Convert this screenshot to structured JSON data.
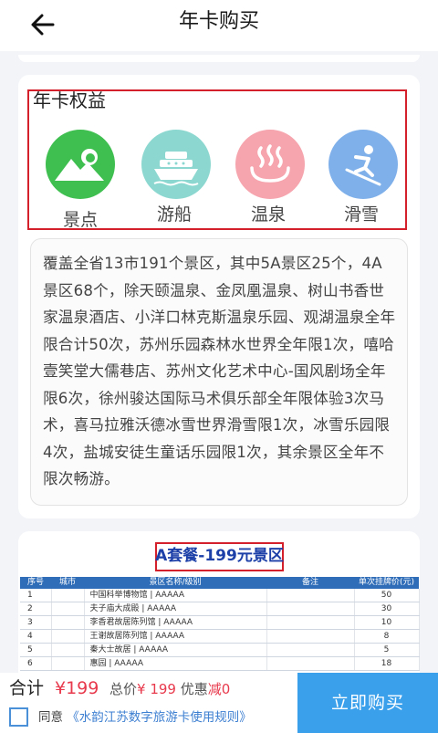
{
  "header": {
    "title": "年卡购买",
    "back_icon": "arrow-left-icon"
  },
  "benefits": {
    "title": "年卡权益",
    "items": [
      {
        "label": "景点",
        "icon": "mountain-sun-icon",
        "color": "#3fbf50"
      },
      {
        "label": "游船",
        "icon": "cruise-ship-icon",
        "color": "#8cd8d0"
      },
      {
        "label": "温泉",
        "icon": "hot-spring-icon",
        "color": "#f6a4ad"
      },
      {
        "label": "滑雪",
        "icon": "skier-icon",
        "color": "#7fb0ea"
      }
    ],
    "description": "覆盖全省13市191个景区，其中5A景区25个，4A景区68个，除天颐温泉、金凤凰温泉、树山书香世家温泉酒店、小洋口林克斯温泉乐园、观湖温泉全年限合计50次，苏州乐园森林水世界全年限1次，嘻哈壹笑堂大儒巷店、苏州文化艺术中心-国风剧场全年限6次，徐州骏达国际马术俱乐部全年限体验3次马术，喜马拉雅沃德冰雪世界滑雪限1次，冰雪乐园限4次，盐城安徒生童话乐园限1次，其余景区全年不限次畅游。"
  },
  "package": {
    "title": "A套餐-199元景区",
    "columns": [
      "序号",
      "城市",
      "景区名称/级别",
      "备注",
      "单次挂牌价(元)"
    ],
    "rows": [
      {
        "no": "1",
        "city": "",
        "name": "中国科举博物馆 | AAAAA",
        "note": "",
        "price": "50"
      },
      {
        "no": "2",
        "city": "",
        "name": "夫子庙大成殿 | AAAAA",
        "note": "",
        "price": "30"
      },
      {
        "no": "3",
        "city": "",
        "name": "李香君故居陈列馆 | AAAAA",
        "note": "",
        "price": "10"
      },
      {
        "no": "4",
        "city": "",
        "name": "王谢故居陈列馆 | AAAAA",
        "note": "",
        "price": "8"
      },
      {
        "no": "5",
        "city": "",
        "name": "秦大士故居 | AAAAA",
        "note": "",
        "price": "5"
      },
      {
        "no": "6",
        "city": "",
        "name": "惠园 | AAAAA",
        "note": "",
        "price": "18"
      }
    ]
  },
  "footer": {
    "total_label": "合计",
    "total_price": "¥199",
    "original_label": "总价",
    "original_price": "¥ 199",
    "discount_label": "优惠",
    "discount_prefix": "减",
    "discount_value": "0",
    "agree_prefix": "同意",
    "agree_link": "《水韵江苏数字旅游卡使用规则》",
    "buy_label": "立即购买",
    "accent": "#3aa0ec",
    "price_color": "#e83a4d"
  }
}
